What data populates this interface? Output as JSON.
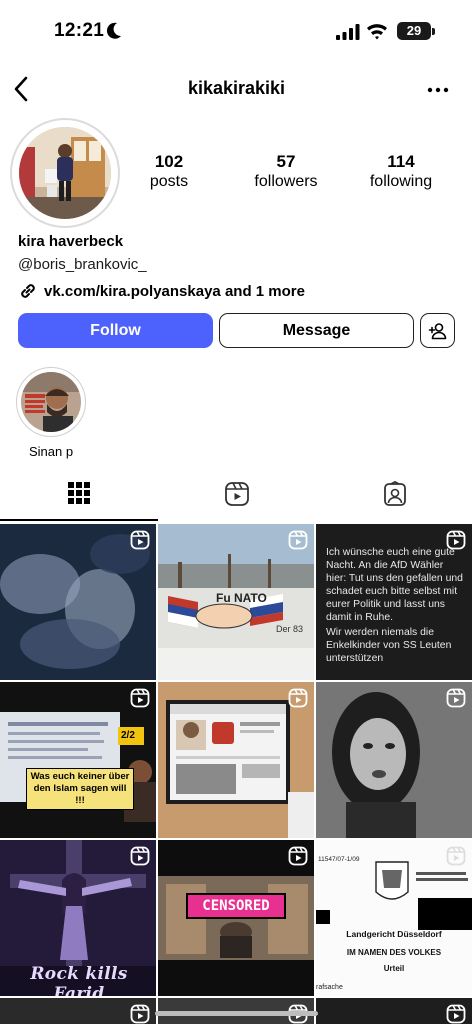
{
  "status_bar": {
    "time": "12:21",
    "battery": "29"
  },
  "header": {
    "username": "kikakirakiki"
  },
  "profile": {
    "stats": [
      {
        "count": "102",
        "label": "posts"
      },
      {
        "count": "57",
        "label": "followers"
      },
      {
        "count": "114",
        "label": "following"
      }
    ],
    "display_name": "kira haverbeck",
    "handle": "@boris_brankovic_",
    "link": "vk.com/kira.polyanskaya and 1 more"
  },
  "actions": {
    "follow": "Follow",
    "message": "Message"
  },
  "highlights": [
    {
      "label": "Sinan p"
    }
  ],
  "tabs": [
    {
      "icon": "grid-icon",
      "active": true
    },
    {
      "icon": "reels-icon"
    },
    {
      "icon": "tagged-icon"
    }
  ],
  "posts": {
    "graffiti_text": "Fu  NATO",
    "graffiti_tag": "Der 83",
    "text_post": "Ich wünsche euch eine gute Nacht. An die AfD Wähler hier: Tut uns den gefallen und schadet euch bitte selbst mit eurer Politik und lasst uns damit in Ruhe.",
    "text_post_2": "Wir werden niemals die Enkelkinder von SS Leuten unterstützen",
    "video_badge": "2/2",
    "video_caption": "Was euch keiner über den Islam sagen will !!!",
    "censored_label": "CENSORED",
    "album_title": "Rock kills Farid",
    "doc_number": "11547/07-1/09",
    "doc_court": "Landgericht Düsseldorf",
    "doc_heading": "IM NAMEN DES VOLKES",
    "doc_verdict": "Urteil",
    "doc_small": "rafsache"
  },
  "colors": {
    "accent": "#4d61fc",
    "text": "#000000",
    "border": "#dbdbdb"
  }
}
